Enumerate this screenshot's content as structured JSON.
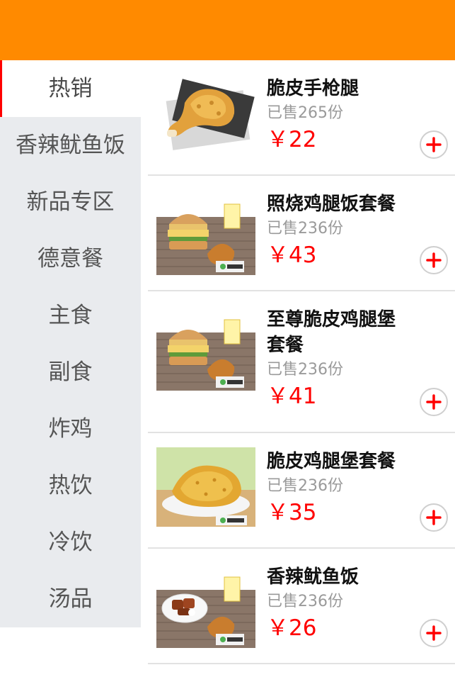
{
  "header": {
    "background": "#ff8a00"
  },
  "sidebar": {
    "items": [
      {
        "label": "热销",
        "active": true
      },
      {
        "label": "香辣鱿鱼饭",
        "active": false
      },
      {
        "label": "新品专区",
        "active": false
      },
      {
        "label": "德意餐",
        "active": false
      },
      {
        "label": "主食",
        "active": false
      },
      {
        "label": "副食",
        "active": false
      },
      {
        "label": "炸鸡",
        "active": false
      },
      {
        "label": "热饮",
        "active": false
      },
      {
        "label": "冷饮",
        "active": false
      },
      {
        "label": "汤品",
        "active": false
      }
    ]
  },
  "products": [
    {
      "name": "脆皮手枪腿",
      "sold": "已售265份",
      "price": "￥22",
      "image": "fried-drumstick"
    },
    {
      "name": "照烧鸡腿饭套餐",
      "sold": "已售236份",
      "price": "￥43",
      "image": "burger-combo"
    },
    {
      "name": "至尊脆皮鸡腿堡套餐",
      "sold": "已售236份",
      "price": "￥41",
      "image": "burger-combo"
    },
    {
      "name": "脆皮鸡腿堡套餐",
      "sold": "已售236份",
      "price": "￥35",
      "image": "fried-cutlet"
    },
    {
      "name": "香辣鱿鱼饭",
      "sold": "已售236份",
      "price": "￥26",
      "image": "squid-rice-combo"
    }
  ],
  "add_icon": "plus-icon",
  "colors": {
    "accent": "#ff0000",
    "header": "#ff8a00",
    "sidebar_bg": "#e9ebee"
  }
}
